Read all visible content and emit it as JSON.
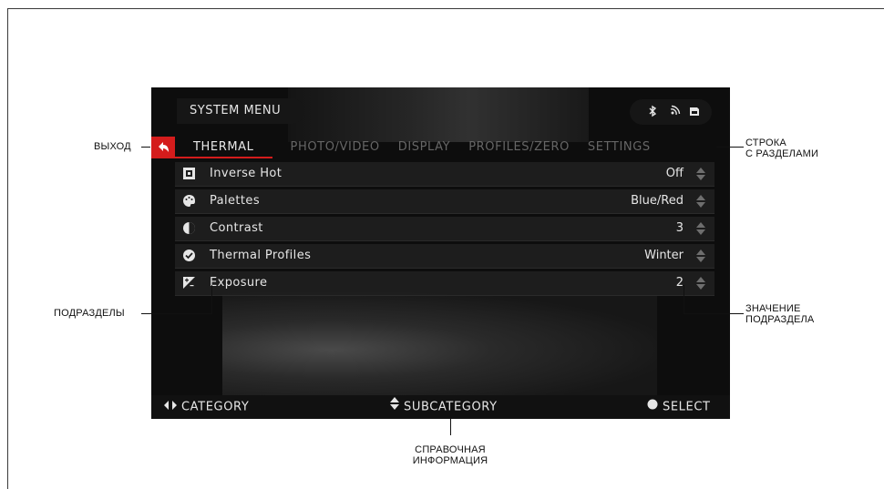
{
  "screen": {
    "title": "SYSTEM MENU",
    "status_icons": [
      "bluetooth-icon",
      "wifi-icon",
      "sd-card-icon"
    ],
    "tabs": [
      {
        "label": "THERMAL",
        "active": true
      },
      {
        "label": "PHOTO/VIDEO",
        "active": false
      },
      {
        "label": "DISPLAY",
        "active": false
      },
      {
        "label": "PROFILES/ZERO",
        "active": false
      },
      {
        "label": "SETTINGS",
        "active": false
      }
    ],
    "items": [
      {
        "label": "Inverse Hot",
        "value": "Off",
        "icon": "inverse-hot-icon"
      },
      {
        "label": "Palettes",
        "value": "Blue/Red",
        "icon": "palette-icon"
      },
      {
        "label": "Contrast",
        "value": "3",
        "icon": "contrast-icon"
      },
      {
        "label": "Thermal Profiles",
        "value": "Winter",
        "icon": "check-circle-icon"
      },
      {
        "label": "Exposure",
        "value": "2",
        "icon": "exposure-icon"
      }
    ],
    "help": {
      "category": "CATEGORY",
      "subcategory": "SUBCATEGORY",
      "select": "SELECT"
    }
  },
  "callouts": {
    "exit": "ВЫХОД",
    "section_bar_1": "СТРОКА",
    "section_bar_2": "С РАЗДЕЛАМИ",
    "subsections": "ПОДРАЗДЕЛЫ",
    "value_1": "ЗНАЧЕНИЕ",
    "value_2": "ПОДРАЗДЕЛА",
    "help_1": "СПРАВОЧНАЯ",
    "help_2": "ИНФОРМАЦИЯ"
  },
  "colors": {
    "accent": "#d41c1c",
    "screen_bg": "#0d0d0d",
    "text": "#e6e6e6",
    "inactive_tab": "#666666"
  }
}
